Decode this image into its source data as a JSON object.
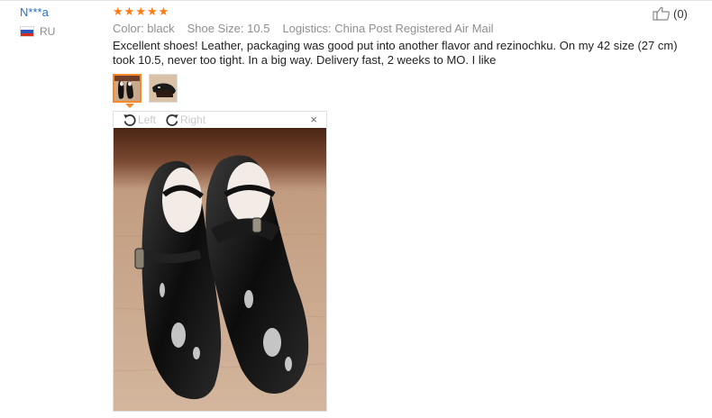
{
  "review": {
    "user_name": "N***a",
    "country_code": "RU",
    "rating": 5,
    "star_glyph": "★",
    "attributes": {
      "color": "Color: black",
      "shoe_size": "Shoe Size: 10.5",
      "logistics": "Logistics: China Post Registered Air Mail"
    },
    "text": "Excellent shoes! Leather, packaging was good put into another flavor and rezinochku. On my 42 size (27 cm) took 10.5, never too tight. In a big way. Delivery fast, 2 weeks to MO. I like",
    "helpful_count": "(0)"
  },
  "viewer": {
    "rotate_left_label": "Left",
    "rotate_right_label": "Right",
    "close_label": "×"
  },
  "colors": {
    "accent_orange": "#f58a2c",
    "star_orange": "#ff7a12",
    "link_blue": "#2b6ecf",
    "meta_gray": "#8f8f8f"
  },
  "icons": {
    "flag": "russia-flag-icon",
    "helpful": "thumbs-up-icon",
    "rotate_left": "rotate-left-icon",
    "rotate_right": "rotate-right-icon",
    "close": "close-icon"
  }
}
